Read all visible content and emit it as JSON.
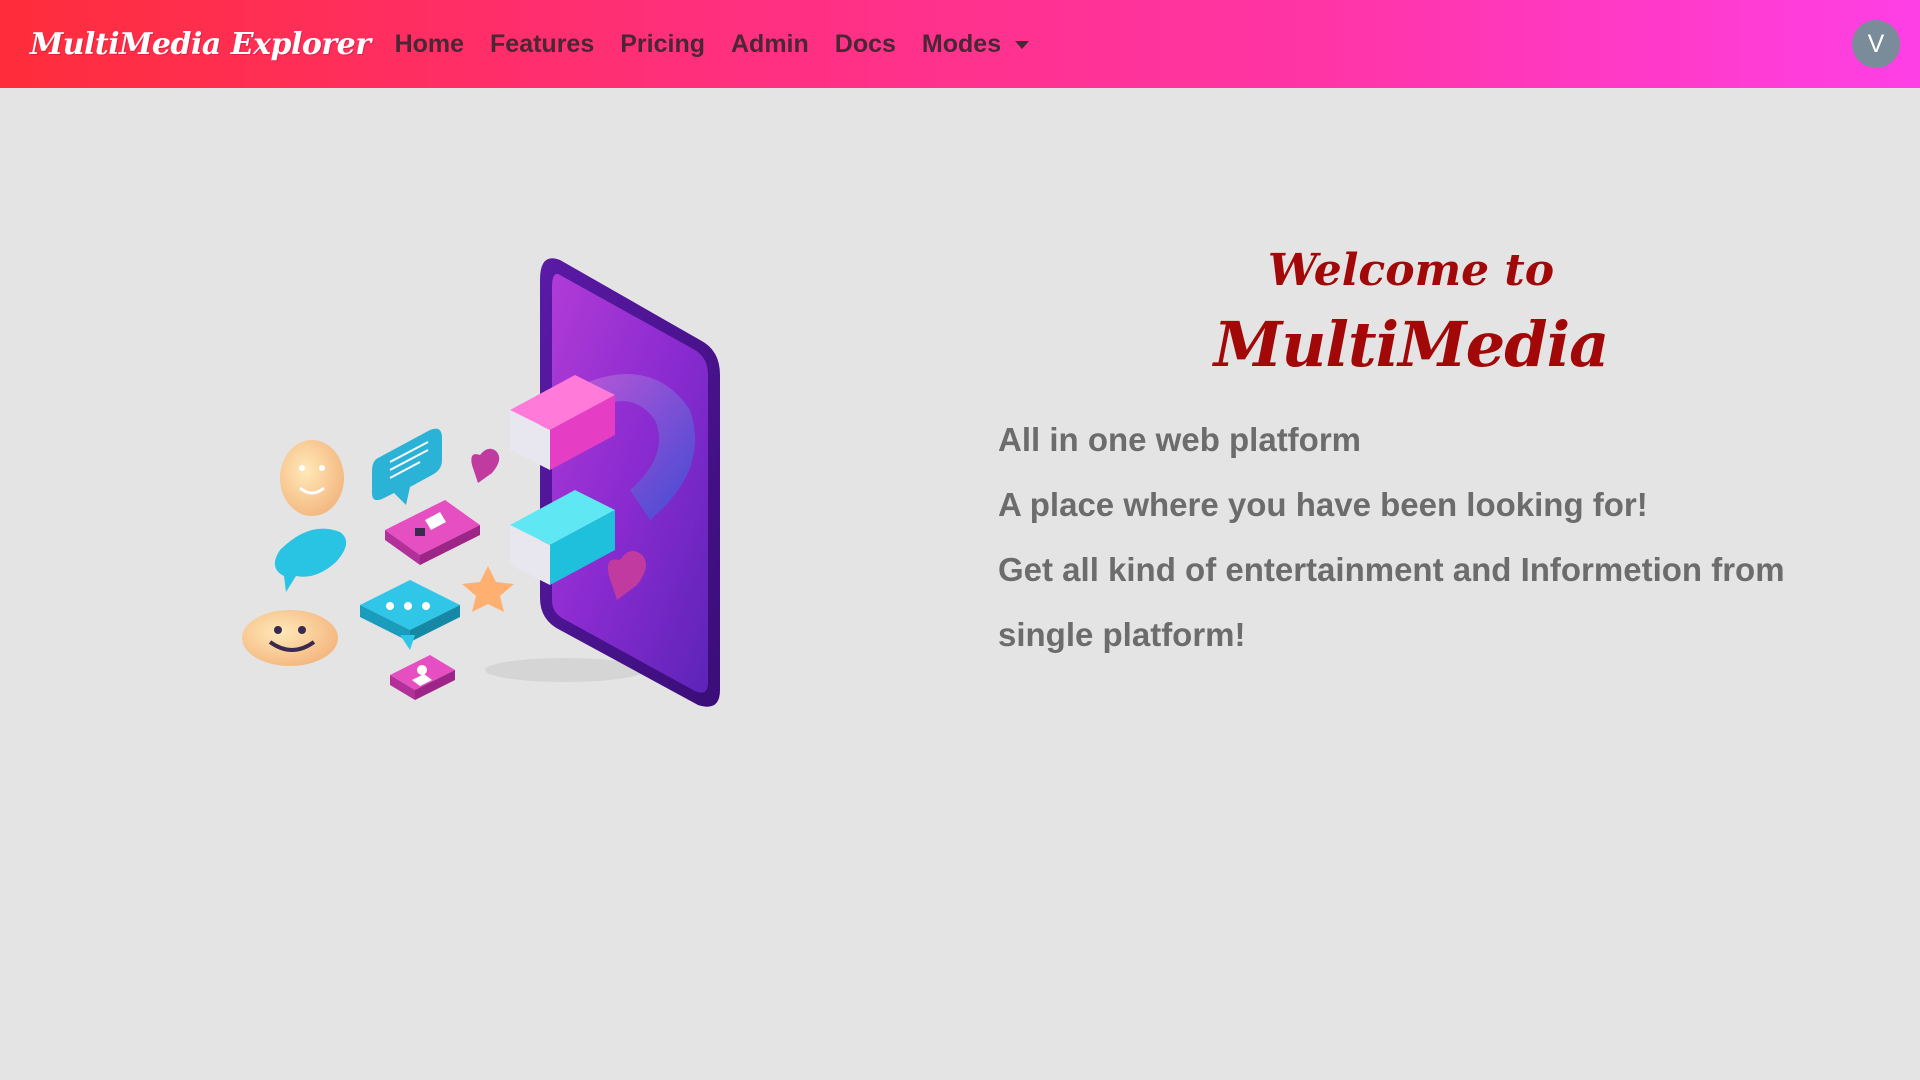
{
  "navbar": {
    "brand": "MultiMedia Explorer",
    "links": [
      "Home",
      "Features",
      "Pricing",
      "Admin",
      "Docs"
    ],
    "dropdown_label": "Modes",
    "avatar_initial": "V",
    "gradient": [
      "#ff2d3a",
      "#ff3fe6"
    ],
    "link_color": "#4a2734"
  },
  "hero": {
    "welcome": "Welcome to",
    "title": "MultiMedia",
    "title_color": "#a30808",
    "line1": "All in one web platform",
    "line2": "A place where you have been looking for!",
    "line3": "Get all kind of entertainment and Informetion from",
    "line4": "single platform!",
    "text_color": "#6c6c6c"
  },
  "illustration": {
    "icons": [
      "smartphone-icon",
      "magnet-icon",
      "smiley-icon",
      "chat-bubble-icon",
      "thumbs-up-icon",
      "heart-icon",
      "star-icon",
      "profile-card-icon"
    ]
  }
}
